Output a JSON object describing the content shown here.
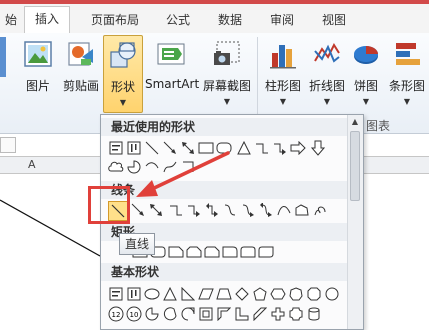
{
  "tabs": [
    {
      "label": "始",
      "active": false
    },
    {
      "label": "插入",
      "active": true
    },
    {
      "label": "页面布局",
      "active": false
    },
    {
      "label": "公式",
      "active": false
    },
    {
      "label": "数据",
      "active": false
    },
    {
      "label": "审阅",
      "active": false
    },
    {
      "label": "视图",
      "active": false
    }
  ],
  "ribbon": {
    "buttons": [
      {
        "label": "图片",
        "icon": "picture-icon"
      },
      {
        "label": "剪贴画",
        "icon": "clipart-icon"
      },
      {
        "label": "形状",
        "icon": "shapes-icon",
        "pressed": true,
        "dropdown_arrow": "▼"
      },
      {
        "label": "SmartArt",
        "icon": "smartart-icon"
      },
      {
        "label": "屏幕截图",
        "icon": "screenshot-icon",
        "dropdown_arrow": "▼"
      },
      {
        "label": "柱形图",
        "icon": "column-chart-icon",
        "dropdown_arrow": "▼"
      },
      {
        "label": "折线图",
        "icon": "line-chart-icon",
        "dropdown_arrow": "▼"
      },
      {
        "label": "饼图",
        "icon": "pie-chart-icon",
        "dropdown_arrow": "▼"
      },
      {
        "label": "条形图",
        "icon": "bar-chart-icon",
        "dropdown_arrow": "▼"
      }
    ],
    "group_label_charts": "图表"
  },
  "sheet": {
    "column_a": "A"
  },
  "shapes_panel": {
    "section_recent": "最近使用的形状",
    "section_lines": "线条",
    "section_rect": "矩形",
    "section_basic": "基本形状",
    "selected_shape": "直线",
    "tooltip": "直线"
  },
  "annotation": {
    "color": "#e0403a"
  }
}
